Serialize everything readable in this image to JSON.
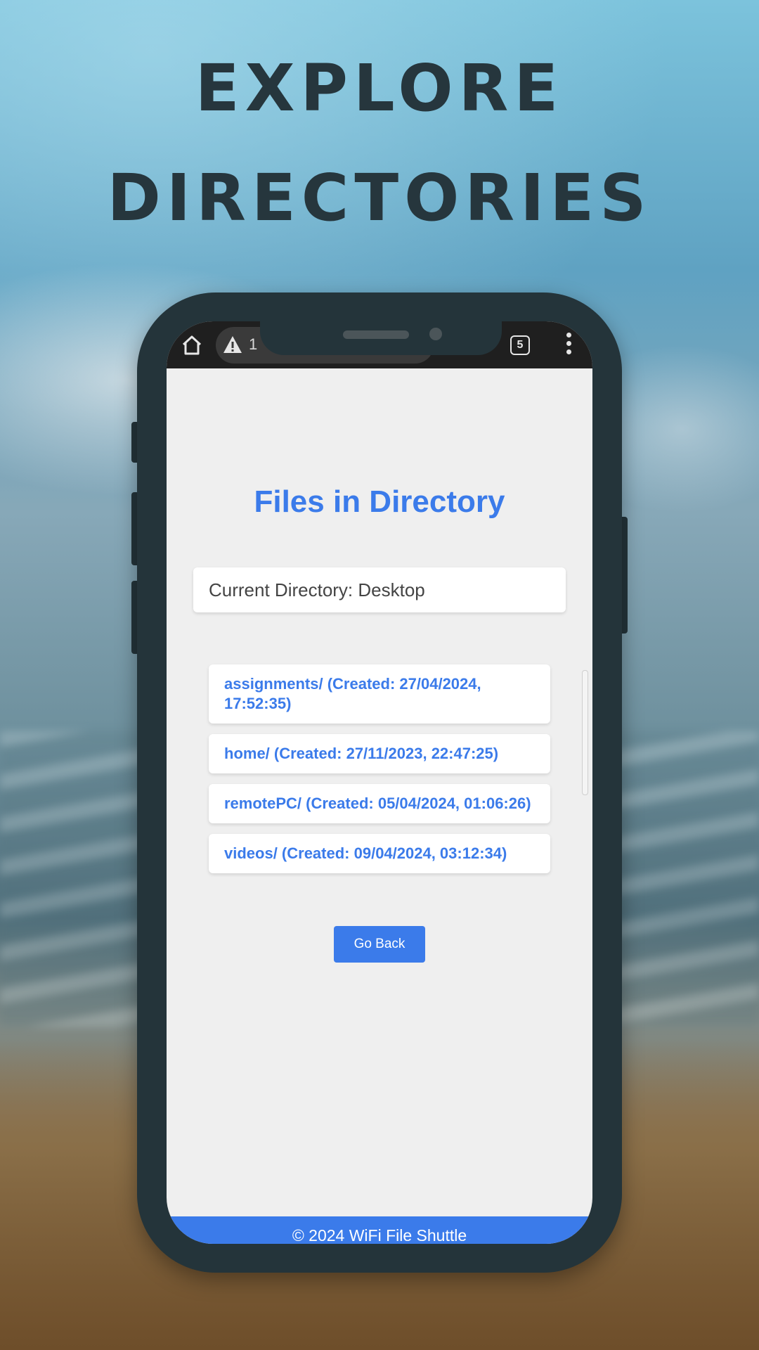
{
  "headline": {
    "line1": "EXPLORE",
    "line2": "DIRECTORIES"
  },
  "browser": {
    "url_fragment": "1",
    "tab_count": "5"
  },
  "page": {
    "title": "Files in Directory",
    "current_directory_label": "Current Directory: Desktop",
    "items": [
      {
        "label": "assignments/ (Created: 27/04/2024, 17:52:35)"
      },
      {
        "label": "home/ (Created: 27/11/2023, 22:47:25)"
      },
      {
        "label": "remotePC/ (Created: 05/04/2024, 01:06:26)"
      },
      {
        "label": "videos/ (Created: 09/04/2024, 03:12:34)"
      }
    ],
    "go_back_label": "Go Back",
    "footer": "© 2024 WiFi File Shuttle"
  },
  "colors": {
    "accent": "#3b7bea",
    "headline": "#26363d",
    "phone_frame": "#24343a"
  },
  "icons": {
    "home": "home-icon",
    "warning": "warning-icon",
    "tabs": "tabs-icon",
    "menu": "more-vert-icon"
  }
}
